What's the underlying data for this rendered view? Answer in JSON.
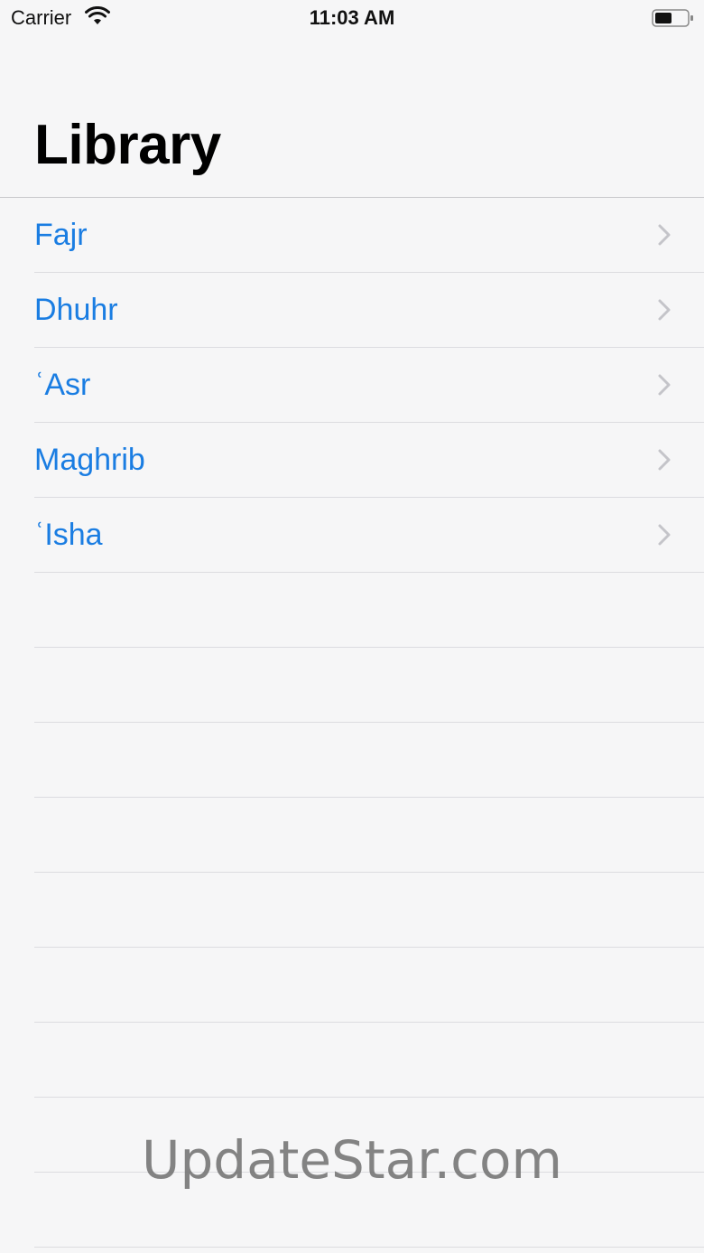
{
  "status_bar": {
    "carrier": "Carrier",
    "time": "11:03 AM",
    "icons": [
      "wifi-icon",
      "battery-icon"
    ]
  },
  "nav": {
    "title": "Library"
  },
  "list": {
    "items": [
      {
        "label": "Fajr"
      },
      {
        "label": "Dhuhr"
      },
      {
        "label": "ʿAsr"
      },
      {
        "label": "Maghrib"
      },
      {
        "label": "ʿIsha"
      }
    ],
    "empty_rows": 9
  },
  "watermark": "UpdateStar.com",
  "colors": {
    "accent": "#1a7de2",
    "background": "#f6f6f7",
    "separator": "#dcdce0",
    "chevron": "#c4c4c9"
  }
}
